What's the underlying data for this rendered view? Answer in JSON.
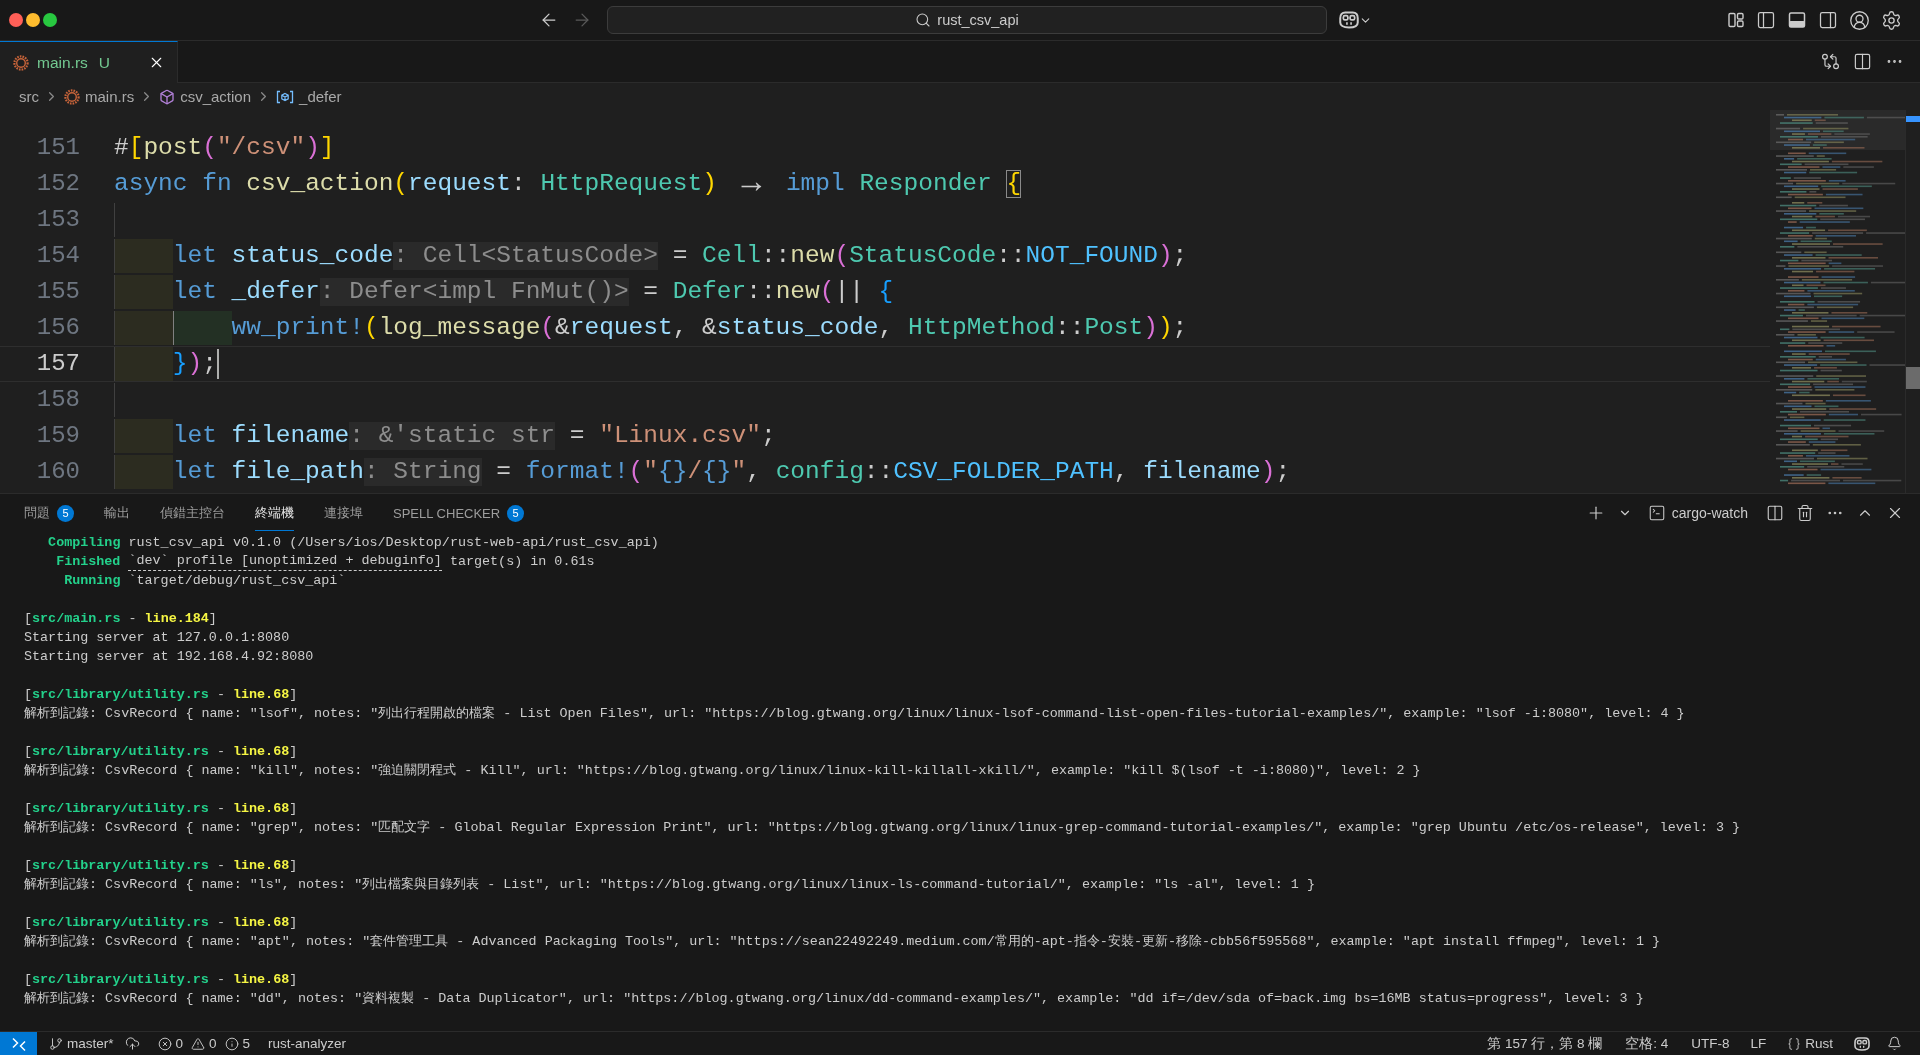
{
  "window": {
    "title": "rust_csv_api",
    "back_enabled": true,
    "forward_enabled": false
  },
  "editor": {
    "tabs": [
      {
        "label": "main.rs",
        "decoration": "U",
        "selected": true
      }
    ],
    "breadcrumbs": [
      {
        "label": "src",
        "kind": "folder"
      },
      {
        "label": "main.rs",
        "kind": "file"
      },
      {
        "label": "csv_action",
        "kind": "function"
      },
      {
        "label": "_defer",
        "kind": "variable"
      }
    ],
    "lines": [
      {
        "number": "151",
        "current": false,
        "tokens": [
          {
            "text": "#",
            "kind": "plain"
          },
          {
            "text": "[",
            "kind": "bracket1"
          },
          {
            "text": "post",
            "kind": "function"
          },
          {
            "text": "(",
            "kind": "bracket2"
          },
          {
            "text": "\"/csv\"",
            "kind": "string"
          },
          {
            "text": ")",
            "kind": "bracket2"
          },
          {
            "text": "]",
            "kind": "bracket1"
          }
        ]
      },
      {
        "number": "152",
        "current": false,
        "tokens": [
          {
            "text": "async fn ",
            "kind": "keyword"
          },
          {
            "text": "csv_action",
            "kind": "function"
          },
          {
            "text": "(",
            "kind": "bracket1"
          },
          {
            "text": "request",
            "kind": "variable"
          },
          {
            "text": ": ",
            "kind": "plain"
          },
          {
            "text": "HttpRequest",
            "kind": "type"
          },
          {
            "text": ") ",
            "kind": "bracket1"
          },
          {
            "text": "→",
            "kind": "arrow"
          },
          {
            "text": " impl ",
            "kind": "keyword"
          },
          {
            "text": "Responder ",
            "kind": "type"
          },
          {
            "text": "{",
            "kind": "bracket_match"
          }
        ],
        "children": [
          {
            "number": "153",
            "current": false
          },
          {
            "number": "154",
            "current": false,
            "tokens": [
              {
                "text": "let ",
                "kind": "keyword"
              },
              {
                "text": "status_code",
                "kind": "variable"
              },
              {
                "text": ": Cell<StatusCode>",
                "kind": "hint"
              },
              {
                "text": " = ",
                "kind": "plain"
              },
              {
                "text": "Cell",
                "kind": "type"
              },
              {
                "text": "::",
                "kind": "plain"
              },
              {
                "text": "new",
                "kind": "function"
              },
              {
                "text": "(",
                "kind": "bracket2"
              },
              {
                "text": "StatusCode",
                "kind": "type"
              },
              {
                "text": "::",
                "kind": "plain"
              },
              {
                "text": "NOT_FOUND",
                "kind": "constant"
              },
              {
                "text": ")",
                "kind": "bracket2"
              },
              {
                "text": ";",
                "kind": "plain"
              }
            ]
          },
          {
            "number": "155",
            "current": false,
            "tokens": [
              {
                "text": "let ",
                "kind": "keyword"
              },
              {
                "text": "_defer",
                "kind": "variable"
              },
              {
                "text": ": Defer<impl FnMut()>",
                "kind": "hint"
              },
              {
                "text": " = ",
                "kind": "plain"
              },
              {
                "text": "Defer",
                "kind": "type"
              },
              {
                "text": "::",
                "kind": "plain"
              },
              {
                "text": "new",
                "kind": "function"
              },
              {
                "text": "(",
                "kind": "bracket2"
              },
              {
                "text": "|| ",
                "kind": "plain"
              },
              {
                "text": "{",
                "kind": "bracket3"
              }
            ],
            "children": [
              {
                "number": "156",
                "current": false,
                "tokens": [
                  {
                    "text": "ww_print!",
                    "kind": "macro"
                  },
                  {
                    "text": "(",
                    "kind": "bracket1"
                  },
                  {
                    "text": "log_message",
                    "kind": "function"
                  },
                  {
                    "text": "(",
                    "kind": "bracket2"
                  },
                  {
                    "text": "&",
                    "kind": "plain"
                  },
                  {
                    "text": "request",
                    "kind": "variable"
                  },
                  {
                    "text": ", &",
                    "kind": "plain"
                  },
                  {
                    "text": "status_code",
                    "kind": "variable"
                  },
                  {
                    "text": ", ",
                    "kind": "plain"
                  },
                  {
                    "text": "HttpMethod",
                    "kind": "type"
                  },
                  {
                    "text": "::",
                    "kind": "plain"
                  },
                  {
                    "text": "Post",
                    "kind": "type"
                  },
                  {
                    "text": ")",
                    "kind": "bracket2"
                  },
                  {
                    "text": ")",
                    "kind": "bracket1"
                  },
                  {
                    "text": ";",
                    "kind": "plain"
                  }
                ]
              }
            ]
          },
          {
            "number": "157",
            "current": true,
            "tokens": [
              {
                "text": "}",
                "kind": "bracket3"
              },
              {
                "text": ")",
                "kind": "bracket2"
              },
              {
                "text": ";",
                "kind": "plain"
              }
            ]
          },
          {
            "number": "158",
            "current": false
          },
          {
            "number": "159",
            "current": false,
            "tokens": [
              {
                "text": "let ",
                "kind": "keyword"
              },
              {
                "text": "filename",
                "kind": "variable"
              },
              {
                "text": ": &'static str",
                "kind": "hint"
              },
              {
                "text": " = ",
                "kind": "plain"
              },
              {
                "text": "\"Linux.csv\"",
                "kind": "string"
              },
              {
                "text": ";",
                "kind": "plain"
              }
            ]
          },
          {
            "number": "160",
            "current": false,
            "tokens": [
              {
                "text": "let ",
                "kind": "keyword"
              },
              {
                "text": "file_path",
                "kind": "variable"
              },
              {
                "text": ": String",
                "kind": "hint"
              },
              {
                "text": " = ",
                "kind": "plain"
              },
              {
                "text": "format!",
                "kind": "macro"
              },
              {
                "text": "(",
                "kind": "bracket2"
              },
              {
                "text": "\"",
                "kind": "string"
              },
              {
                "text": "{}",
                "kind": "format"
              },
              {
                "text": "/",
                "kind": "string"
              },
              {
                "text": "{}",
                "kind": "format"
              },
              {
                "text": "\"",
                "kind": "string"
              },
              {
                "text": ", ",
                "kind": "plain"
              },
              {
                "text": "config",
                "kind": "type"
              },
              {
                "text": "::",
                "kind": "plain"
              },
              {
                "text": "CSV_FOLDER_PATH",
                "kind": "constant"
              },
              {
                "text": ", ",
                "kind": "plain"
              },
              {
                "text": "filename",
                "kind": "variable"
              },
              {
                "text": ")",
                "kind": "bracket2"
              },
              {
                "text": ";",
                "kind": "plain"
              }
            ]
          }
        ]
      }
    ]
  },
  "panel": {
    "tabs": [
      {
        "label": "問題",
        "badge": "5",
        "selected": false
      },
      {
        "label": "輸出",
        "selected": false
      },
      {
        "label": "偵錯主控台",
        "selected": false
      },
      {
        "label": "終端機",
        "selected": true
      },
      {
        "label": "連接埠",
        "selected": false
      },
      {
        "label": "SPELL CHECKER",
        "badge": "5",
        "selected": false
      }
    ],
    "terminal_tab": "cargo-watch",
    "terminal": {
      "build": [
        {
          "status": "Compiling",
          "detail": "rust_csv_api v0.1.0 (/Users/ios/Desktop/rust-web-api/rust_csv_api)"
        },
        {
          "status": "Finished",
          "link": "`dev` profile [unoptimized + debuginfo]",
          "detail": "target(s) in 0.61s"
        },
        {
          "status": "Running",
          "detail": "`target/debug/rust_csv_api`"
        }
      ],
      "logs": [
        {
          "source": "[**src/main.rs** - **line.184**]",
          "lines": [
            "Starting server at 127.0.0.1:8080",
            "Starting server at 192.168.4.92:8080"
          ]
        },
        {
          "source": "[**src/library/utility.rs** - **line.68**]",
          "lines": [
            "解析到記錄: CsvRecord { name: \"lsof\", notes: \"列出行程開啟的檔案 - List Open Files\", url: \"https://blog.gtwang.org/linux/linux-lsof-command-list-open-files-tutorial-examples/\", example: \"lsof -i:8080\", level: 4 }"
          ]
        },
        {
          "source": "[**src/library/utility.rs** - **line.68**]",
          "lines": [
            "解析到記錄: CsvRecord { name: \"kill\", notes: \"強迫關閉程式 - Kill\", url: \"https://blog.gtwang.org/linux/linux-kill-killall-xkill/\", example: \"kill $(lsof -t -i:8080)\", level: 2 }"
          ]
        },
        {
          "source": "[**src/library/utility.rs** - **line.68**]",
          "lines": [
            "解析到記錄: CsvRecord { name: \"grep\", notes: \"匹配文字 - Global Regular Expression Print\", url: \"https://blog.gtwang.org/linux/linux-grep-command-tutorial-examples/\", example: \"grep Ubuntu /etc/os-release\", level: 3 }"
          ]
        },
        {
          "source": "[**src/library/utility.rs** - **line.68**]",
          "lines": [
            "解析到記錄: CsvRecord { name: \"ls\", notes: \"列出檔案與目錄列表 - List\", url: \"https://blog.gtwang.org/linux/linux-ls-command-tutorial/\", example: \"ls -al\", level: 1 }"
          ]
        },
        {
          "source": "[**src/library/utility.rs** - **line.68**]",
          "lines": [
            "解析到記錄: CsvRecord { name: \"apt\", notes: \"套件管理工具 - Advanced Packaging Tools\", url: \"https://sean22492249.medium.com/常用的-apt-指令-安裝-更新-移除-cbb56f595568\", example: \"apt install ffmpeg\", level: 1 }"
          ]
        },
        {
          "source": "[**src/library/utility.rs** - **line.68**]",
          "lines": [
            "解析到記錄: CsvRecord { name: \"dd\", notes: \"資料複製 - Data Duplicator\", url: \"https://blog.gtwang.org/linux/dd-command-examples/\", example: \"dd if=/dev/sda of=back.img bs=16MB status=progress\", level: 3 }"
          ]
        }
      ]
    }
  },
  "status_bar": {
    "branch": "master*",
    "errors": "0",
    "warnings": "0",
    "infos": "5",
    "language_server": "rust-analyzer",
    "cursor_position": "第 157 行，第 8 欄",
    "indentation": "空格: 4",
    "encoding": "UTF-8",
    "eol": "LF",
    "language": "Rust"
  }
}
